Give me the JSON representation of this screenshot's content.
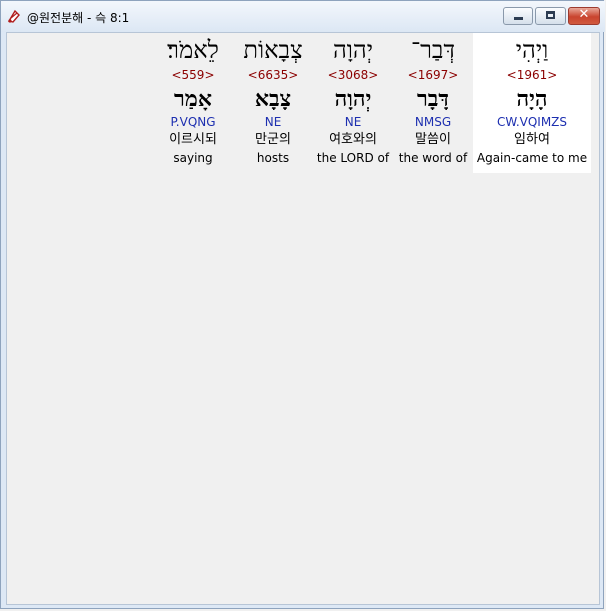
{
  "window": {
    "title": "@원전분해 - 슥 8:1",
    "minimize_label": "",
    "maximize_label": "",
    "close_label": "✕"
  },
  "colors": {
    "strong_number": "#8b0000",
    "morphology": "#1d2fb0",
    "selected_background": "#ffffff"
  },
  "words": [
    {
      "hebrew": "וַיְהִי",
      "strong": "<1961>",
      "root": "הָיָה",
      "morph": "CW.VQIMZS",
      "korean": "임하여",
      "english": "Again-came to me",
      "selected": true
    },
    {
      "hebrew": "דְּבַר־",
      "strong": "<1697>",
      "root": "דָּבָר",
      "morph": "NMSG",
      "korean": "말씀이",
      "english": "the word of",
      "selected": false
    },
    {
      "hebrew": "יְהוָה",
      "strong": "<3068>",
      "root": "יְהוָה",
      "morph": "NE",
      "korean": "여호와의",
      "english": "the LORD of",
      "selected": false
    },
    {
      "hebrew": "צְבָאוֹת",
      "strong": "<6635>",
      "root": "צָבָא",
      "morph": "NE",
      "korean": "만군의",
      "english": "hosts",
      "selected": false
    },
    {
      "hebrew": "לֵאמֹר׃",
      "strong": "<559>",
      "root": "אָמַר",
      "morph": "P.VQNG",
      "korean": "이르시되",
      "english": "saying",
      "selected": false
    }
  ]
}
